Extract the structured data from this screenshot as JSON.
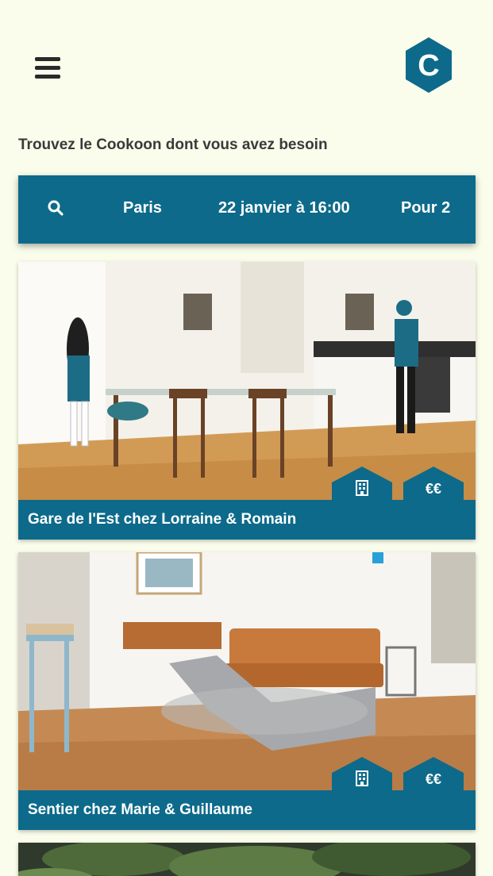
{
  "header": {
    "menu_icon": "hamburger-menu-icon",
    "logo_letter": "C",
    "brand_color": "#0d6a8b"
  },
  "headline": "Trouvez le Cookoon dont vous avez besoin",
  "search": {
    "icon": "search-icon",
    "city": "Paris",
    "datetime": "22 janvier à 16:00",
    "guests": "Pour 2"
  },
  "listings": [
    {
      "title": "Gare de l'Est chez Lorraine & Romain",
      "type_icon": "building-icon",
      "price": "€€"
    },
    {
      "title": "Sentier chez Marie & Guillaume",
      "type_icon": "building-icon",
      "price": "€€"
    }
  ],
  "colors": {
    "background": "#fafdeb",
    "accent": "#0d6a8b"
  }
}
